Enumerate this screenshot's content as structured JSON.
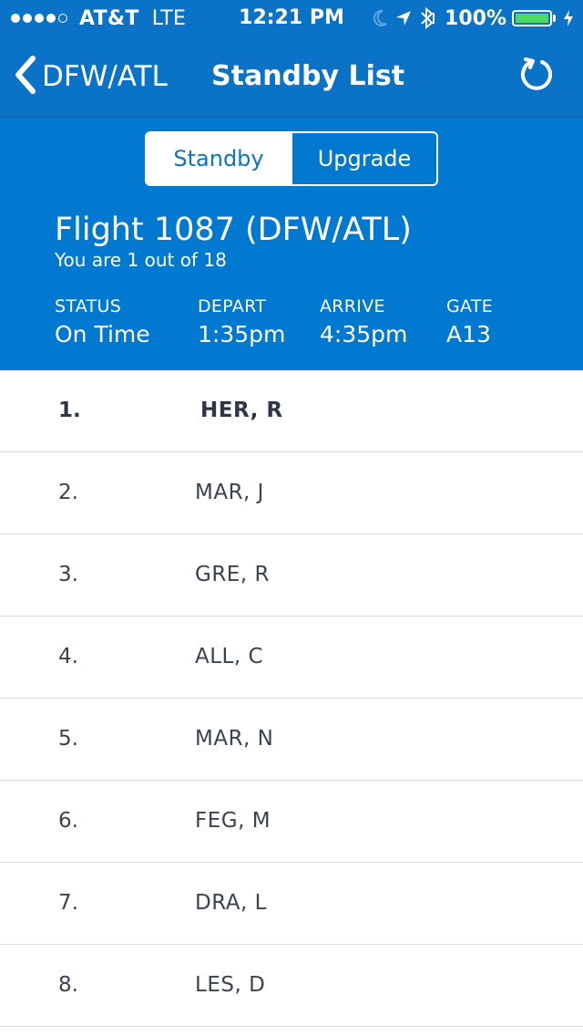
{
  "status_bar": {
    "carrier": "AT&T",
    "network": "LTE",
    "time": "12:21 PM",
    "battery_percent": "100%",
    "battery_level": 1.0,
    "battery_color": "#4cd964",
    "icons": [
      "signal-dots",
      "moon-icon",
      "location-arrow-icon",
      "bluetooth-icon",
      "battery-icon",
      "charging-bolt-icon"
    ]
  },
  "nav": {
    "back_label": "DFW/ATL",
    "back_icon": "chevron-left-icon",
    "title": "Standby List",
    "refresh_icon": "refresh-icon"
  },
  "tabs": [
    {
      "label": "Standby",
      "selected": true
    },
    {
      "label": "Upgrade",
      "selected": false
    }
  ],
  "flight": {
    "title": "Flight 1087 (DFW/ATL)",
    "position_text": "You are 1 out of 18",
    "status_label": "STATUS",
    "status_value": "On Time",
    "depart_label": "DEPART",
    "depart_value": "1:35pm",
    "arrive_label": "ARRIVE",
    "arrive_value": "4:35pm",
    "gate_label": "GATE",
    "gate_value": "A13"
  },
  "standby_list": [
    {
      "number": "1.",
      "name": "HER, R",
      "current_user": true
    },
    {
      "number": "2.",
      "name": "MAR, J"
    },
    {
      "number": "3.",
      "name": "GRE, R"
    },
    {
      "number": "4.",
      "name": "ALL, C"
    },
    {
      "number": "5.",
      "name": "MAR, N"
    },
    {
      "number": "6.",
      "name": "FEG, M"
    },
    {
      "number": "7.",
      "name": "DRA, L"
    },
    {
      "number": "8.",
      "name": "LES, D"
    }
  ],
  "colors": {
    "header_bg": "#0a73c8",
    "panel_bg": "#0179d1",
    "text_dark": "#3a4350",
    "divider": "#d9d9d9"
  }
}
